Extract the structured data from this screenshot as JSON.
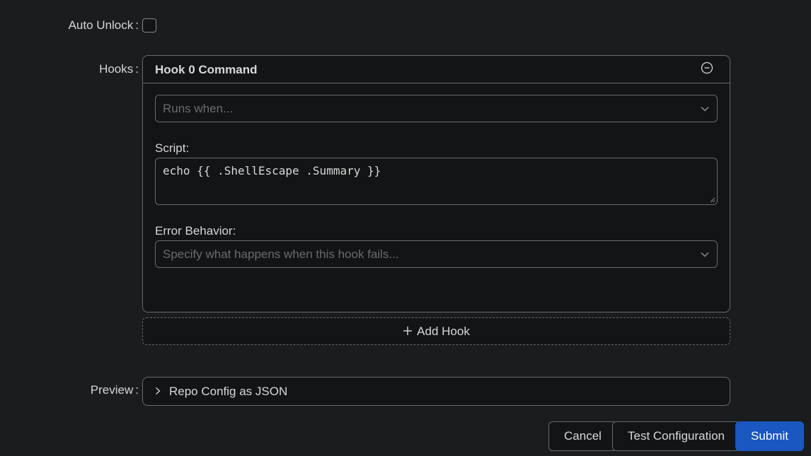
{
  "auto_unlock": {
    "label": "Auto Unlock",
    "colon": ":",
    "checked": false
  },
  "hooks": {
    "label": "Hooks",
    "colon": ":",
    "items": [
      {
        "title": "Hook 0 Command",
        "remove_icon": "minus-circle-icon",
        "runs_when_placeholder": "Runs when...",
        "script_label": "Script:",
        "script_value": "echo {{ .ShellEscape .Summary }}",
        "error_behavior_label": "Error Behavior:",
        "error_behavior_placeholder": "Specify what happens when this hook fails..."
      }
    ],
    "add_label": "Add Hook",
    "add_icon": "plus-icon"
  },
  "preview": {
    "label": "Preview",
    "colon": ":",
    "toggle_text": "Repo Config as JSON",
    "toggle_icon": "chevron-right-icon"
  },
  "actions": {
    "cancel": "Cancel",
    "test": "Test Configuration",
    "submit": "Submit"
  },
  "colors": {
    "background": "#1b1c1e",
    "panel": "#131416",
    "border": "#6a6a6a",
    "primary": "#1a57c0"
  }
}
